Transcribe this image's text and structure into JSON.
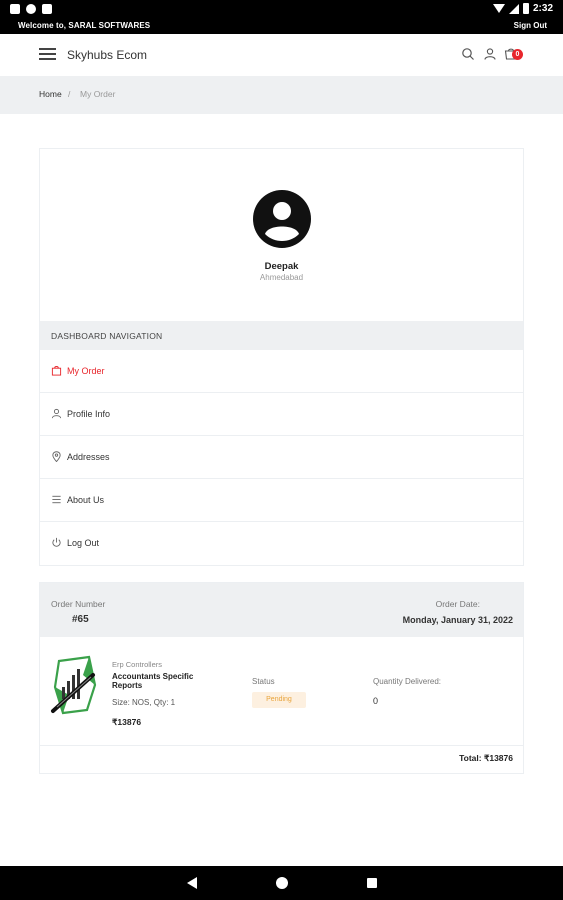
{
  "status_bar": {
    "welcome": "Welcome to, SARAL SOFTWARES",
    "signout": "Sign Out",
    "time": "2:32"
  },
  "header": {
    "brand": "Skyhubs Ecom",
    "cart_count": "0",
    "icons": [
      "menu-icon",
      "search-icon",
      "user-icon",
      "cart-icon"
    ]
  },
  "breadcrumb": {
    "home": "Home",
    "separator": "/",
    "current": "My Order"
  },
  "profile": {
    "name": "Deepak",
    "city": "Ahmedabad"
  },
  "dashboard": {
    "heading": "DASHBOARD NAVIGATION",
    "items": [
      {
        "label": "My Order",
        "icon": "bag-icon",
        "active": true
      },
      {
        "label": "Profile Info",
        "icon": "user-icon",
        "active": false
      },
      {
        "label": "Addresses",
        "icon": "location-pin-icon",
        "active": false
      },
      {
        "label": "About Us",
        "icon": "list-icon",
        "active": false
      },
      {
        "label": "Log Out",
        "icon": "power-icon",
        "active": false
      }
    ]
  },
  "order": {
    "number_label": "Order Number",
    "number": "#65",
    "date_label": "Order Date:",
    "date": "Monday, January 31, 2022",
    "item": {
      "category": "Erp Controllers",
      "name": "Accountants Specific Reports",
      "size_qty": "Size: NOS, Qty: 1",
      "price": "₹13876"
    },
    "status_label": "Status",
    "status": "Pending",
    "qty_delivered_label": "Quantity Delivered:",
    "qty_delivered": "0",
    "total": "Total: ₹13876"
  },
  "colors": {
    "accent": "#e8262c",
    "pending_text": "#e8a33a",
    "pending_bg": "#fdf0e0",
    "panel_bg": "#eef0f2"
  }
}
